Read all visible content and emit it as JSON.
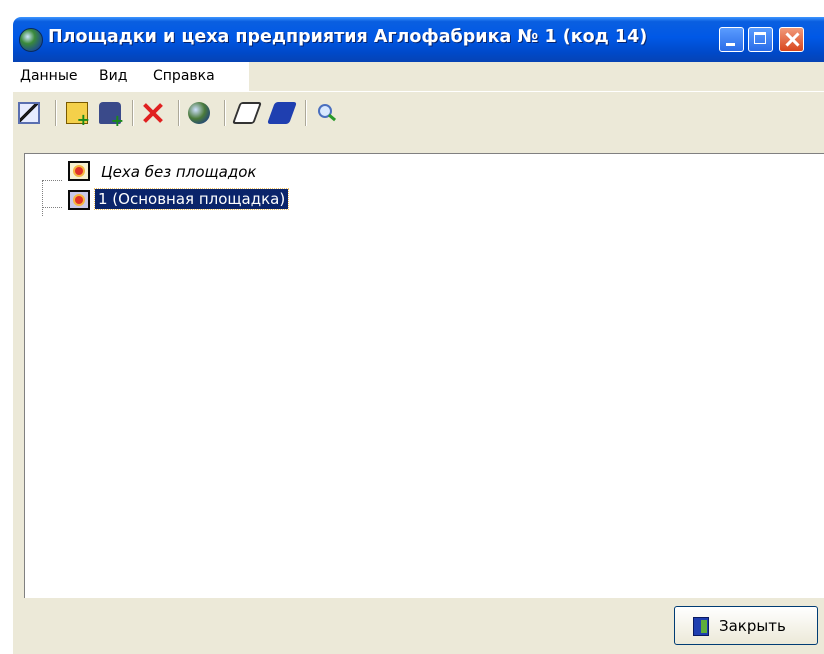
{
  "window": {
    "title": "Площадки и цеха предприятия Аглофабрика № 1 (код 14)"
  },
  "menu": {
    "items": [
      "Данные",
      "Вид",
      "Справка"
    ]
  },
  "toolbar": {
    "buttons": [
      "edit-icon",
      "add-site-icon",
      "add-workshop-icon",
      "delete-icon",
      "refresh-icon",
      "expand-icon",
      "collapse-icon",
      "find-icon"
    ]
  },
  "tree": {
    "nodes": [
      {
        "label": "Цеха без площадок",
        "italic": true,
        "selected": false
      },
      {
        "label": "1 (Основная площадка)",
        "italic": false,
        "selected": true
      }
    ]
  },
  "footer": {
    "close_label": "Закрыть"
  },
  "colors": {
    "titlebar": "#0058e6",
    "selection": "#0a246a",
    "window_bg": "#ece9d8"
  }
}
